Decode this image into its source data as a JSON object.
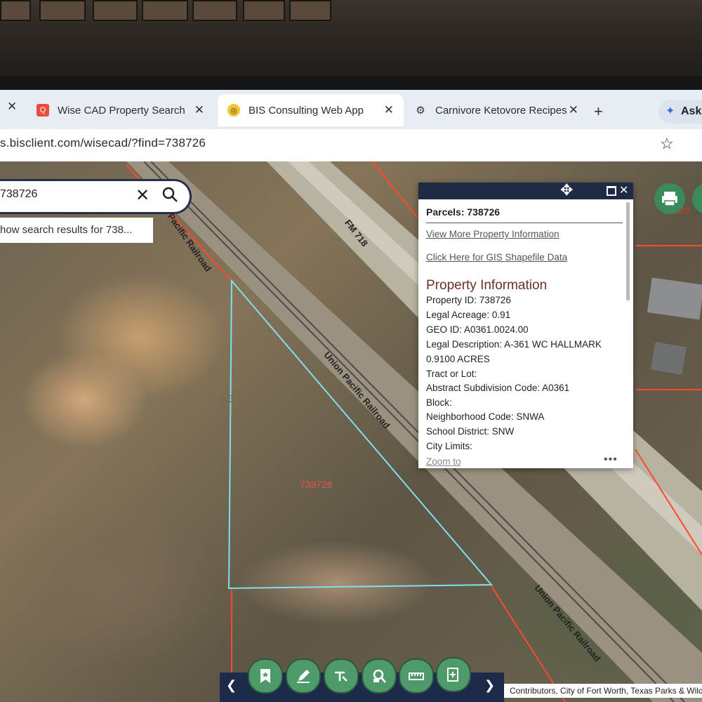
{
  "browser": {
    "tabs": [
      {
        "title": "Wise CAD Property Search"
      },
      {
        "title": "BIS Consulting Web App"
      },
      {
        "title": "Carnivore Ketovore Recipes"
      }
    ],
    "ask_label": "Ask",
    "url": "s.bisclient.com/wisecad/?find=738726"
  },
  "search": {
    "value": "738726",
    "suggestion": "how search results for 738..."
  },
  "map": {
    "labels": {
      "union_pacific_1": "Union Pacific Railroad",
      "union_pacific_2": "Union Pacific Railroad",
      "union_pacific_3": "Union Pacific Railroad",
      "fm718": "FM 718",
      "parcel": "738726",
      "abstract": "A 3 1",
      "right_parcel": "323"
    },
    "attribution": "Contributors, City of Fort Worth, Texas Parks & Wildlife"
  },
  "popup": {
    "title": "Parcels: 738726",
    "link_more": "View More Property Information",
    "link_gis": "Click Here for GIS Shapefile Data",
    "section_title": "Property Information",
    "fields": [
      {
        "label": "Property ID:",
        "value": "738726"
      },
      {
        "label": "Legal Acreage:",
        "value": "0.91"
      },
      {
        "label": "GEO ID:",
        "value": "A0361.0024.00"
      },
      {
        "label": "Legal Description:",
        "value": "A-361 WC HALLMARK"
      },
      {
        "label": "",
        "value": "0.9100 ACRES"
      },
      {
        "label": "Tract or Lot:",
        "value": ""
      },
      {
        "label": "Abstract Subdivision Code:",
        "value": "A0361"
      },
      {
        "label": "Block:",
        "value": ""
      },
      {
        "label": "Neighborhood Code:",
        "value": "SNWA"
      },
      {
        "label": "School District:",
        "value": "SNW"
      },
      {
        "label": "City Limits:",
        "value": ""
      }
    ],
    "zoom_link": "Zoom to",
    "more": "•••"
  },
  "toolbar": {
    "tools": [
      "bookmark-icon",
      "draw-icon",
      "measure-icon",
      "parcel-search-icon",
      "scale-icon",
      "print-layout-icon"
    ]
  },
  "colors": {
    "header": "#1f2a44",
    "tool_green": "#4f9a6a",
    "parcel_outline": "#7fe0f0",
    "parcel_line": "#ff4a2e",
    "section_title": "#6b2d2d"
  }
}
